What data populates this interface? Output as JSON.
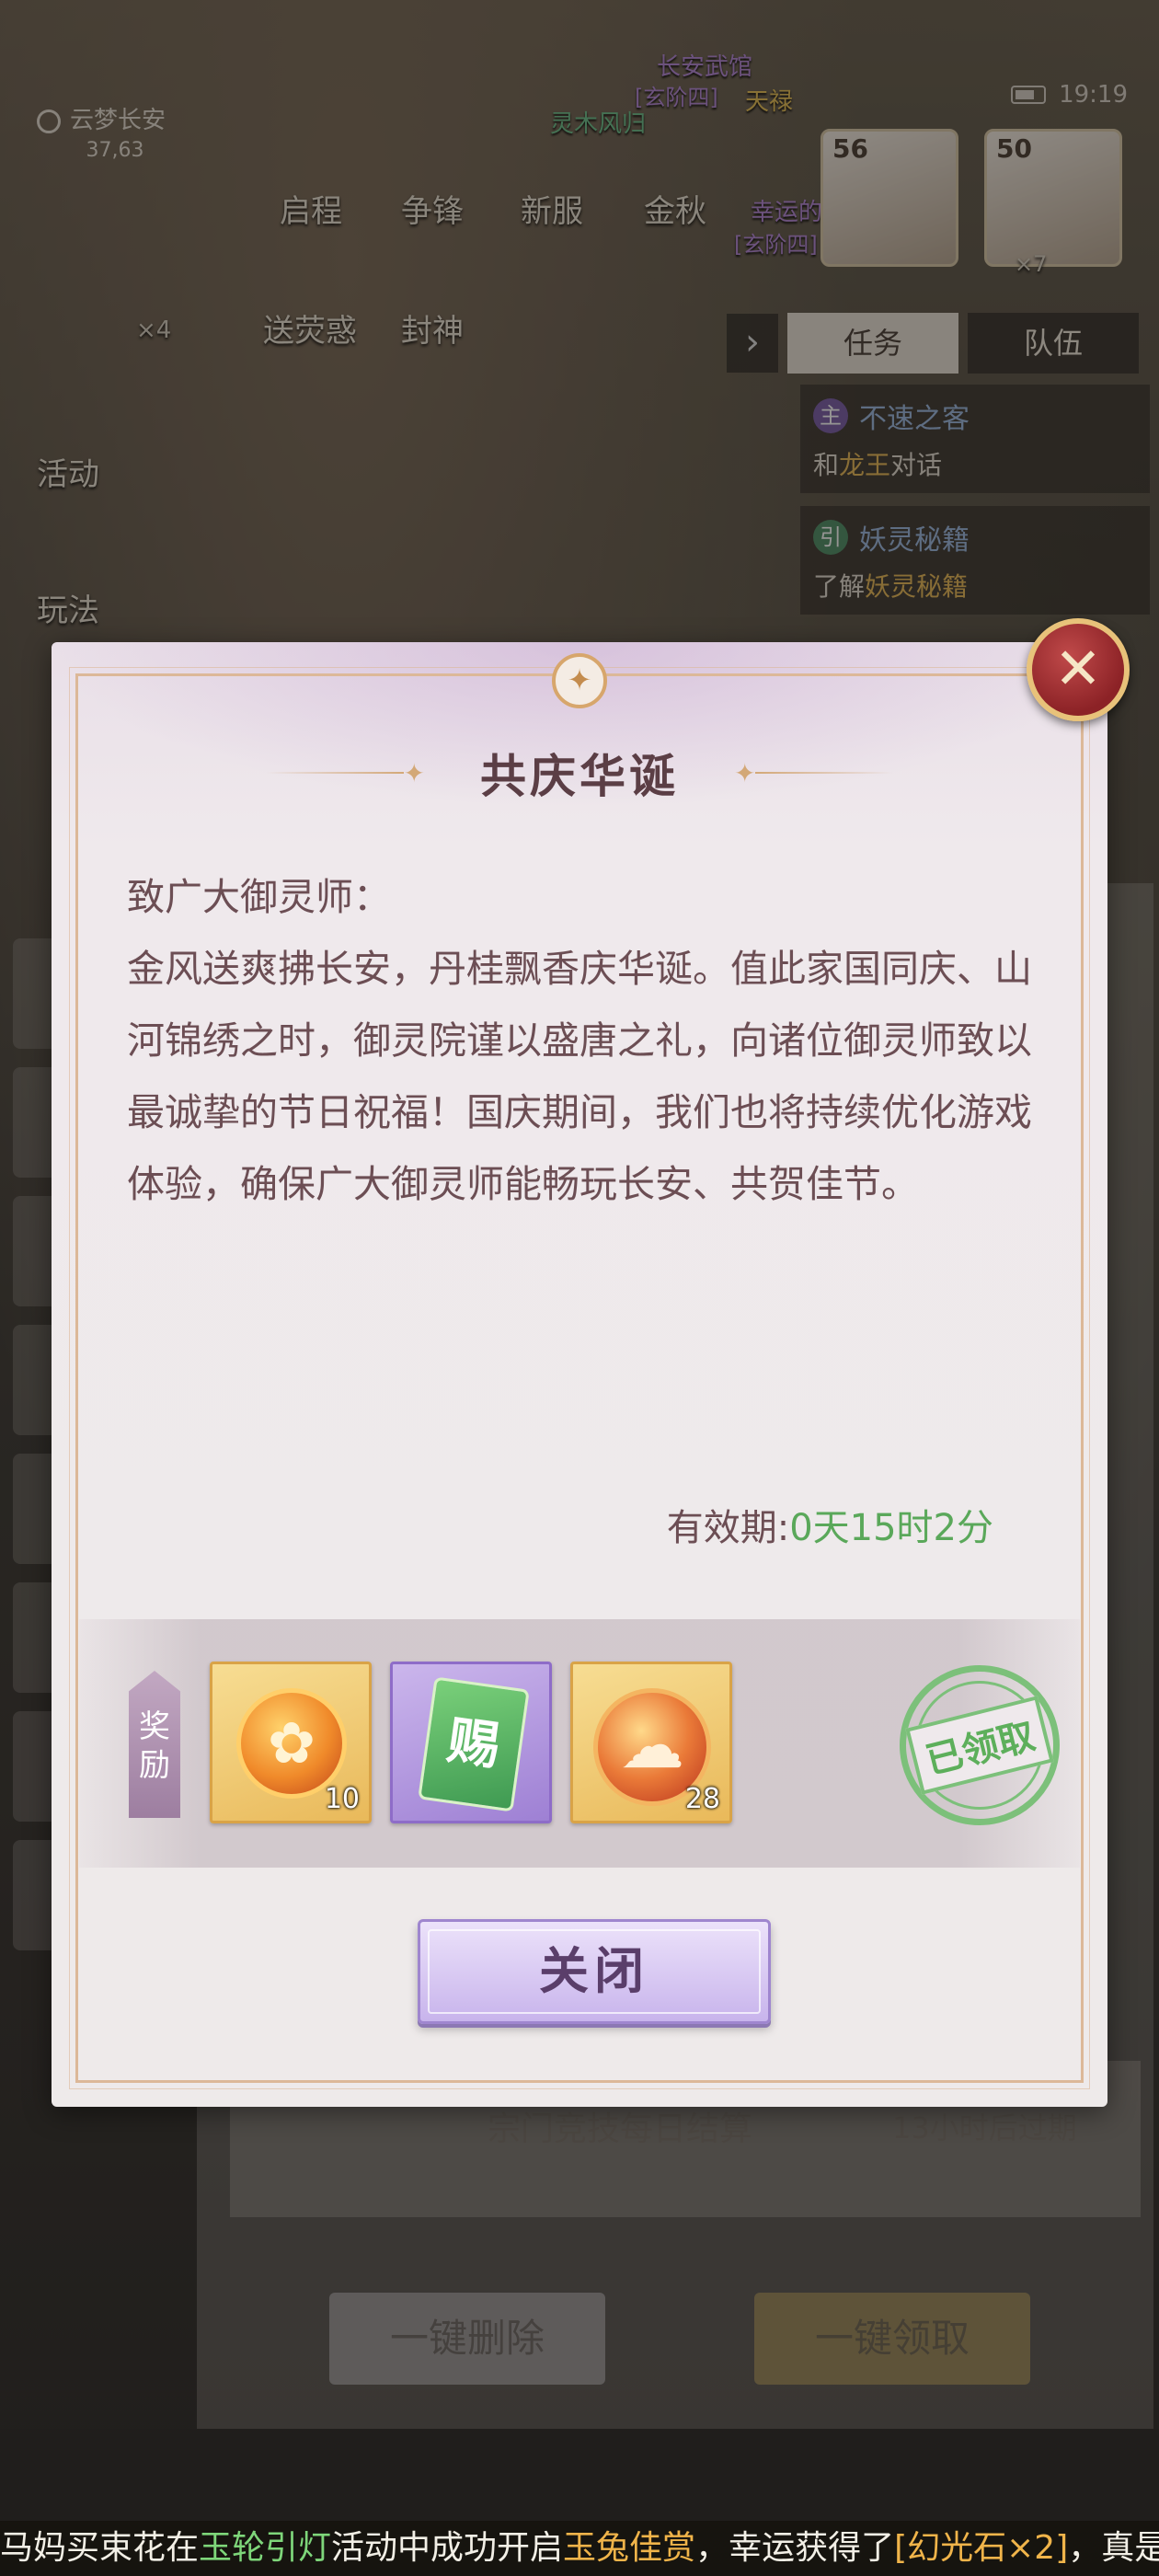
{
  "status": {
    "time": "19:19"
  },
  "location": {
    "name": "云梦长安",
    "coords": "37,63"
  },
  "hud": {
    "buttons": [
      "启程",
      "争锋",
      "新服",
      "金秋",
      "送荧惑",
      "封神",
      "活动",
      "玩法"
    ],
    "npc_titles": [
      "长安武馆",
      "灵木风归",
      "[玄阶四]",
      "天禄",
      "幸运的",
      "[玄阶四]"
    ],
    "badge_count": "×4",
    "portraits": [
      {
        "level": "56"
      },
      {
        "level": "50",
        "count": "×7"
      }
    ]
  },
  "task_panel": {
    "tabs": [
      "任务",
      "队伍"
    ],
    "items": [
      {
        "tag": "主",
        "title": "不速之客",
        "desc_pre": "和",
        "desc_highlight": "龙王",
        "desc_post": "对话"
      },
      {
        "tag": "引",
        "title": "妖灵秘籍",
        "desc_pre": "了解",
        "desc_highlight": "妖灵秘籍",
        "desc_post": ""
      }
    ]
  },
  "mail_background": {
    "row_subject": "宗门竞技每日结算",
    "row_expiry": "13小时后过期",
    "delete_all": "一键删除",
    "claim_all": "一键领取"
  },
  "modal": {
    "title": "共庆华诞",
    "greeting": "致广大御灵师：",
    "body": "金风送爽拂长安，丹桂飘香庆华诞。值此家国同庆、山河锦绣之时，御灵院谨以盛唐之礼，向诸位御灵师致以最诚挚的节日祝福！国庆期间，我们也将持续优化游戏体验，确保广大御灵师能畅玩长安、共贺佳节。",
    "validity_label": "有效期:",
    "validity_value": "0天15时2分",
    "reward_label_1": "奖",
    "reward_label_2": "励",
    "rewards": [
      {
        "icon": "gold-coin-icon",
        "count": "10"
      },
      {
        "icon": "gift-card-icon",
        "glyph": "赐",
        "count": ""
      },
      {
        "icon": "cloud-coin-icon",
        "count": "28"
      }
    ],
    "claimed_stamp": "已领取",
    "close_button": "关闭"
  },
  "ticker": {
    "p1": "马妈买束花在",
    "h1": "玉轮引灯",
    "p2": "活动中成功开启",
    "h2": "玉兔佳赏",
    "p3": "，幸运获得了",
    "h3": "[幻光石×2]",
    "p4": "，真是时来"
  },
  "colors": {
    "title_text": "#5b3e45",
    "body_text": "#6c4e54",
    "validity_green": "#5aa85a",
    "stamp_green": "#6cb86a",
    "button_purple": "#c8b4ec",
    "frame_gold": "#dcb898"
  }
}
